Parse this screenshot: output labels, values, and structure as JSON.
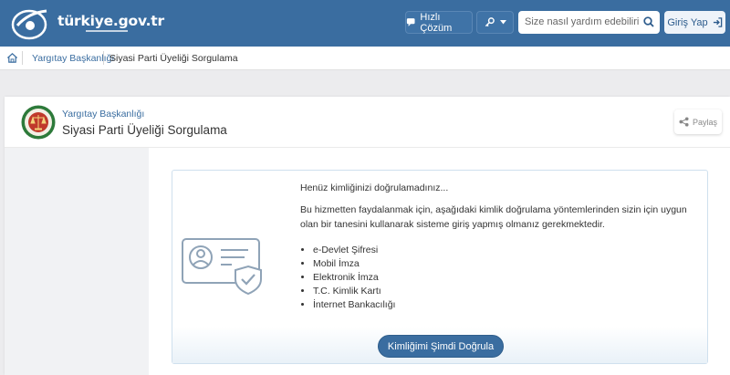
{
  "header": {
    "logo_text": "türkiye.gov.tr",
    "quick_solution_label": "Hızlı Çözüm",
    "search_placeholder": "Size nasıl yardım edebilirim?",
    "login_label": "Giriş Yap"
  },
  "breadcrumb": {
    "items": [
      "Yargıtay Başkanlığı",
      "Siyasi Parti Üyeliği Sorgulama"
    ]
  },
  "service": {
    "institution": "Yargıtay Başkanlığı",
    "title": "Siyasi Parti Üyeliği Sorgulama",
    "share_label": "Paylaş"
  },
  "auth_panel": {
    "heading": "Henüz kimliğinizi doğrulamadınız...",
    "description": "Bu hizmetten faydalanmak için, aşağıdaki kimlik doğrulama yöntemlerinden sizin için uygun olan bir tanesini kullanarak sisteme giriş yapmış olmanız gerekmektedir.",
    "methods": [
      "e-Devlet Şifresi",
      "Mobil İmza",
      "Elektronik İmza",
      "T.C. Kimlik Kartı",
      "İnternet Bankacılığı"
    ],
    "verify_button": "Kimliğimi Şimdi Doğrula"
  },
  "colors": {
    "header_bg": "#3a6da0",
    "accent": "#3a6da0",
    "emblem_green": "#2d7a3a",
    "emblem_red": "#c0392b"
  }
}
